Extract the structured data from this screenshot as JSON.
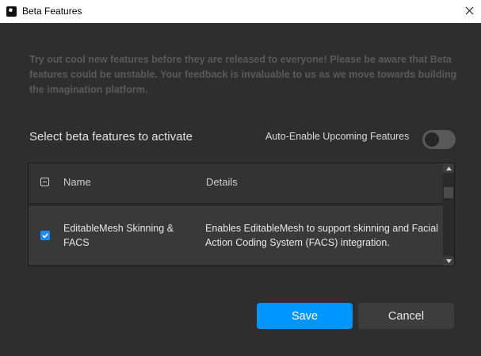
{
  "window": {
    "title": "Beta Features",
    "app_icon": "roblox-studio-icon",
    "close_icon": "close-icon"
  },
  "intro_text": "Try out cool new features before they are released to everyone! Please be aware that Beta features could be unstable. Your feedback is invaluable to us as we move towards building the imagination platform.",
  "select_label": "Select beta features to activate",
  "auto_enable": {
    "label": "Auto-Enable Upcoming Features",
    "enabled": false
  },
  "table": {
    "headers": {
      "name": "Name",
      "details": "Details"
    },
    "rows": [
      {
        "checked": true,
        "name": "EditableMesh Skinning & FACS",
        "details": "Enables EditableMesh to support skinning and Facial Action Coding System (FACS) integration."
      }
    ]
  },
  "buttons": {
    "save": "Save",
    "cancel": "Cancel"
  },
  "colors": {
    "accent": "#0095ff",
    "background": "#2e2e2e",
    "titlebar": "#ffffff"
  }
}
